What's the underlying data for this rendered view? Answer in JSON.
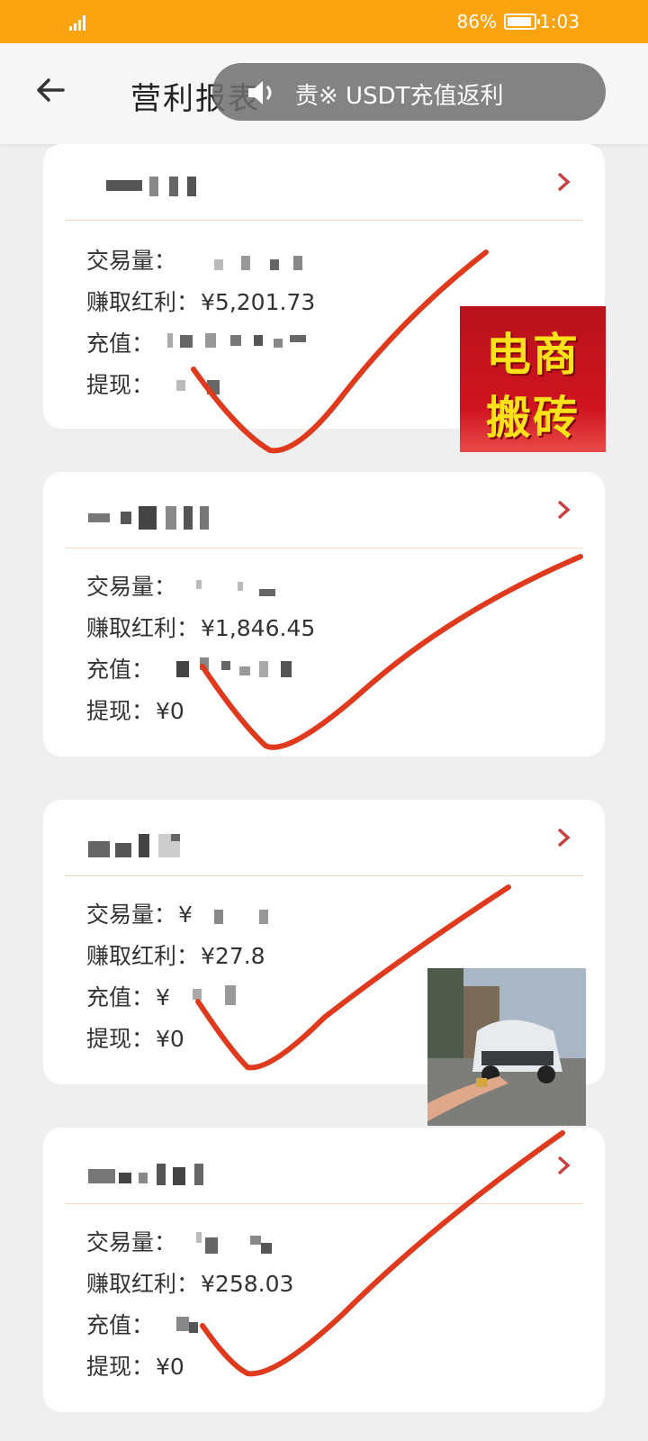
{
  "status_bar": {
    "network": "4G",
    "battery": "86%",
    "time": "1:03"
  },
  "header": {
    "title": "营利报表",
    "toast": "责※ USDT充值返利"
  },
  "cards": [
    {
      "rows": [
        {
          "label": "交易量：",
          "value": ""
        },
        {
          "label": "赚取红利：",
          "value": "¥5,201.73"
        },
        {
          "label": "充值：",
          "value": ""
        },
        {
          "label": "提现：",
          "value": ""
        }
      ]
    },
    {
      "rows": [
        {
          "label": "交易量：",
          "value": ""
        },
        {
          "label": "赚取红利：",
          "value": "¥1,846.45"
        },
        {
          "label": "充值：",
          "value": ""
        },
        {
          "label": "提现：",
          "value": "¥0"
        }
      ]
    },
    {
      "rows": [
        {
          "label": "交易量：",
          "value": "¥"
        },
        {
          "label": "赚取红利：",
          "value": "¥27.8"
        },
        {
          "label": "充值：",
          "value": "¥"
        },
        {
          "label": "提现：",
          "value": "¥0"
        }
      ]
    },
    {
      "rows": [
        {
          "label": "交易量：",
          "value": ""
        },
        {
          "label": "赚取红利：",
          "value": "¥258.03"
        },
        {
          "label": "充值：",
          "value": ""
        },
        {
          "label": "提现：",
          "value": "¥0"
        }
      ]
    }
  ],
  "overlays": {
    "promo_line1": "电商",
    "promo_line2": "搬砖"
  },
  "colors": {
    "status_bar": "#fca310",
    "accent": "#d64545",
    "check_mark": "#e03a1e"
  }
}
